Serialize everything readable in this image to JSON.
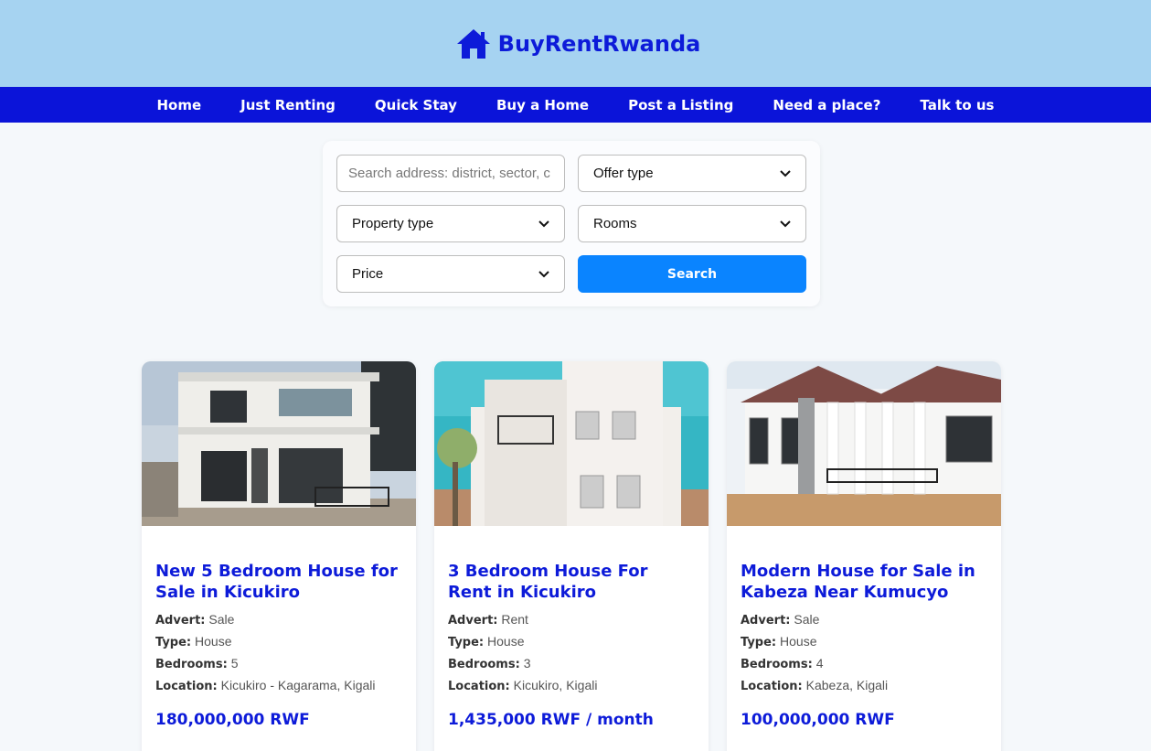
{
  "brand": {
    "name": "BuyRentRwanda",
    "icon": "house-icon",
    "color": "#0d1bd9"
  },
  "colors": {
    "header_bg": "#a6d3f1",
    "nav_bg": "#0b14d9",
    "accent": "#0a84ff"
  },
  "nav": {
    "items": [
      {
        "label": "Home"
      },
      {
        "label": "Just Renting"
      },
      {
        "label": "Quick Stay"
      },
      {
        "label": "Buy a Home"
      },
      {
        "label": "Post a Listing"
      },
      {
        "label": "Need a place?"
      },
      {
        "label": "Talk to us"
      }
    ]
  },
  "search": {
    "placeholder": "Search address: district, sector, c",
    "offer_type": "Offer type",
    "property_type": "Property type",
    "rooms": "Rooms",
    "price": "Price",
    "button": "Search"
  },
  "listings": [
    {
      "title": "New 5 Bedroom House for Sale in Kicukiro",
      "advert_label": "Advert:",
      "advert": "Sale",
      "type_label": "Type:",
      "type": "House",
      "bedrooms_label": "Bedrooms:",
      "bedrooms": "5",
      "location_label": "Location:",
      "location": "Kicukiro - Kagarama, Kigali",
      "price": "180,000,000 RWF"
    },
    {
      "title": "3 Bedroom House For Rent in Kicukiro",
      "advert_label": "Advert:",
      "advert": "Rent",
      "type_label": "Type:",
      "type": "House",
      "bedrooms_label": "Bedrooms:",
      "bedrooms": "3",
      "location_label": "Location:",
      "location": "Kicukiro, Kigali",
      "price": "1,435,000 RWF / month"
    },
    {
      "title": "Modern House for Sale in Kabeza Near Kumucyo",
      "advert_label": "Advert:",
      "advert": "Sale",
      "type_label": "Type:",
      "type": "House",
      "bedrooms_label": "Bedrooms:",
      "bedrooms": "4",
      "location_label": "Location:",
      "location": "Kabeza, Kigali",
      "price": "100,000,000 RWF"
    }
  ]
}
